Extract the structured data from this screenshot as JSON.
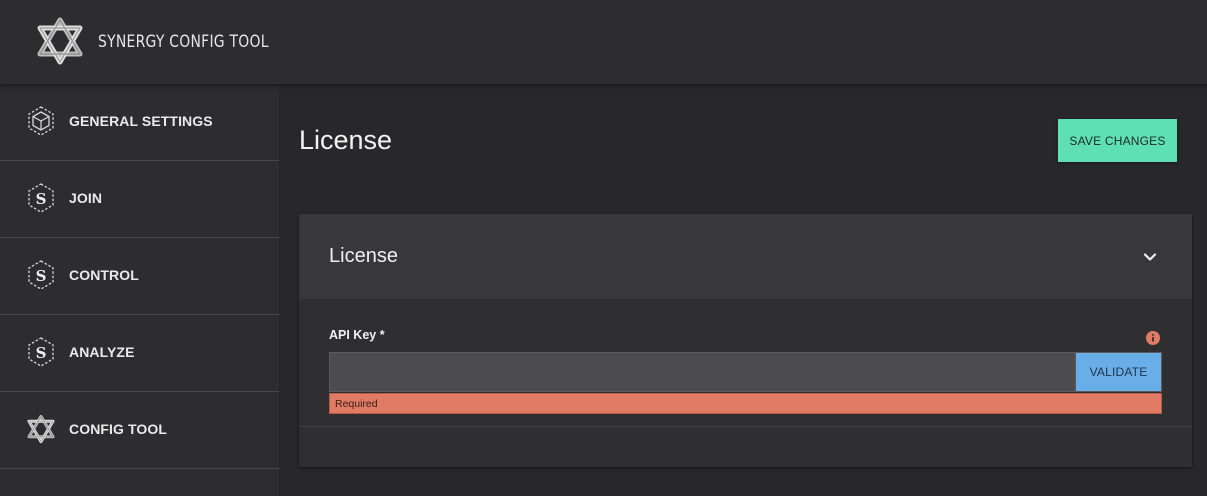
{
  "app": {
    "title": "SYNERGY CONFIG TOOL",
    "logo_icon": "synergy-logo-icon"
  },
  "sidebar": {
    "items": [
      {
        "label": "GENERAL SETTINGS",
        "icon": "hexagon-cube-icon"
      },
      {
        "label": "JOIN",
        "icon": "synergy-s-icon"
      },
      {
        "label": "CONTROL",
        "icon": "synergy-s-icon"
      },
      {
        "label": "ANALYZE",
        "icon": "synergy-s-icon"
      },
      {
        "label": "CONFIG TOOL",
        "icon": "synergy-logo-icon"
      }
    ]
  },
  "main": {
    "page_title": "License",
    "save_label": "SAVE CHANGES",
    "panel": {
      "title": "License",
      "expand_icon": "chevron-down-icon",
      "field": {
        "label": "API Key *",
        "value": "",
        "placeholder": "",
        "info_icon": "info-icon",
        "validate_label": "VALIDATE",
        "error": "Required"
      }
    }
  },
  "colors": {
    "background": "#28282a",
    "sidebar": "#2d2d2f",
    "accent_green": "#5fe0b4",
    "validate_blue": "#6aaee8",
    "error_red": "#e07b66"
  }
}
